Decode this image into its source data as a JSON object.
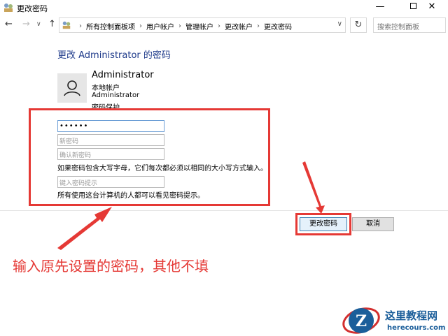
{
  "window": {
    "title": "更改密码",
    "minimize": "—",
    "close": "✕"
  },
  "nav": {
    "back": "←",
    "forward": "→",
    "history": "∨",
    "up": "↑",
    "breadcrumbs": [
      "所有控制面板项",
      "用户帐户",
      "管理帐户",
      "更改帐户",
      "更改密码"
    ],
    "separator": "›",
    "address_dropdown": "∨",
    "refresh": "↻",
    "search_placeholder": "搜索控制面板"
  },
  "page": {
    "heading": "更改 Administrator 的密码"
  },
  "account": {
    "name": "Administrator",
    "type": "本地帐户",
    "group": "Administrator",
    "protection": "密码保护"
  },
  "form": {
    "current_password_value": "••••••",
    "new_password_placeholder": "新密码",
    "confirm_password_placeholder": "确认新密码",
    "case_note": "如果密码包含大写字母，它们每次都必须以相同的大小写方式输入。",
    "hint_placeholder": "键入密码提示",
    "hint_note": "所有使用这台计算机的人都可以看见密码提示。"
  },
  "buttons": {
    "change": "更改密码",
    "cancel": "取消"
  },
  "annotation": {
    "text": "输入原先设置的密码，其他不填",
    "color": "#e53935"
  },
  "watermark": {
    "title": "这里教程网",
    "url": "herecours.com",
    "logo_letter": "Z"
  }
}
